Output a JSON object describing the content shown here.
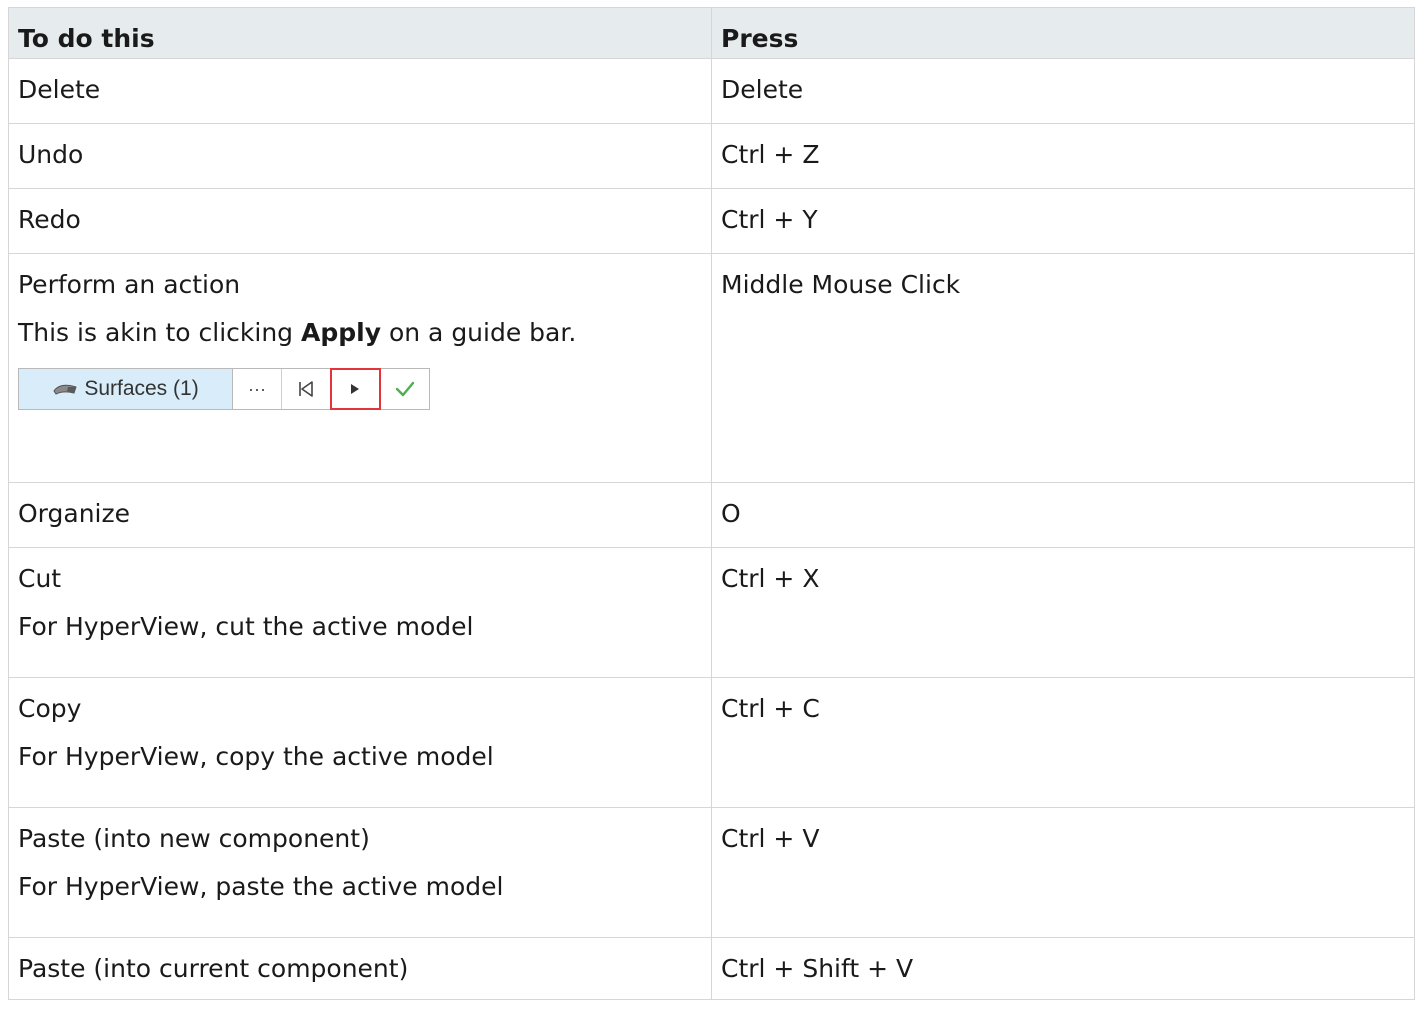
{
  "table": {
    "headers": [
      "To do this",
      "Press"
    ],
    "rows": [
      {
        "action": "Delete",
        "keys": "Delete"
      },
      {
        "action": "Undo",
        "keys": "Ctrl + Z"
      },
      {
        "action": "Redo",
        "keys": "Ctrl + Y"
      },
      {
        "action": "Perform an action",
        "note_before": "This is akin to clicking ",
        "note_bold": "Apply",
        "note_after": " on a guide bar.",
        "keys": "Middle Mouse Click"
      },
      {
        "action": "Organize",
        "keys": "O"
      },
      {
        "action": "Cut",
        "note": "For HyperView, cut the active model",
        "keys": "Ctrl + X"
      },
      {
        "action": "Copy",
        "note": "For HyperView, copy the active model",
        "keys": "Ctrl + C"
      },
      {
        "action": "Paste (into new component)",
        "note": "For HyperView, paste the active model",
        "keys": "Ctrl + V"
      },
      {
        "action": "Paste (into current component)",
        "keys": "Ctrl + Shift + V"
      }
    ]
  },
  "guide_bar": {
    "selector_label": "Surfaces (1)",
    "selector_icon": "surface-icon",
    "buttons": [
      {
        "name": "more-options",
        "glyph": "···",
        "icon": "ellipsis-icon"
      },
      {
        "name": "reset",
        "glyph": "",
        "icon": "skip-back-icon"
      },
      {
        "name": "apply",
        "glyph": "",
        "icon": "play-icon",
        "highlighted": true
      },
      {
        "name": "apply-and-close",
        "glyph": "",
        "icon": "check-icon"
      }
    ],
    "colors": {
      "selector_bg": "#d8ecf9",
      "highlight": "#e3343a",
      "check": "#4caf50"
    }
  }
}
